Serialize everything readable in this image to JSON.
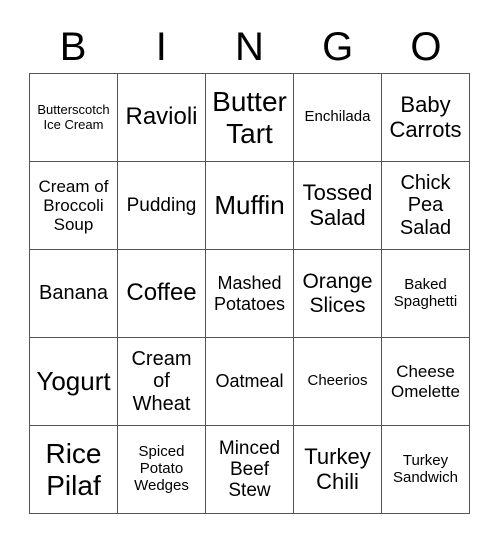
{
  "header": {
    "letters": [
      "B",
      "I",
      "N",
      "G",
      "O"
    ]
  },
  "cells": [
    [
      "Butterscotch\nIce Cream",
      "Ravioli",
      "Butter\nTart",
      "Enchilada",
      "Baby\nCarrots"
    ],
    [
      "Cream of\nBroccoli\nSoup",
      "Pudding",
      "Muffin",
      "Tossed\nSalad",
      "Chick\nPea\nSalad"
    ],
    [
      "Banana",
      "Coffee",
      "Mashed\nPotatoes",
      "Orange\nSlices",
      "Baked\nSpaghetti"
    ],
    [
      "Yogurt",
      "Cream\nof\nWheat",
      "Oatmeal",
      "Cheerios",
      "Cheese\nOmelette"
    ],
    [
      "Rice\nPilaf",
      "Spiced\nPotato\nWedges",
      "Minced\nBeef\nStew",
      "Turkey\nChili",
      "Turkey\nSandwich"
    ]
  ]
}
